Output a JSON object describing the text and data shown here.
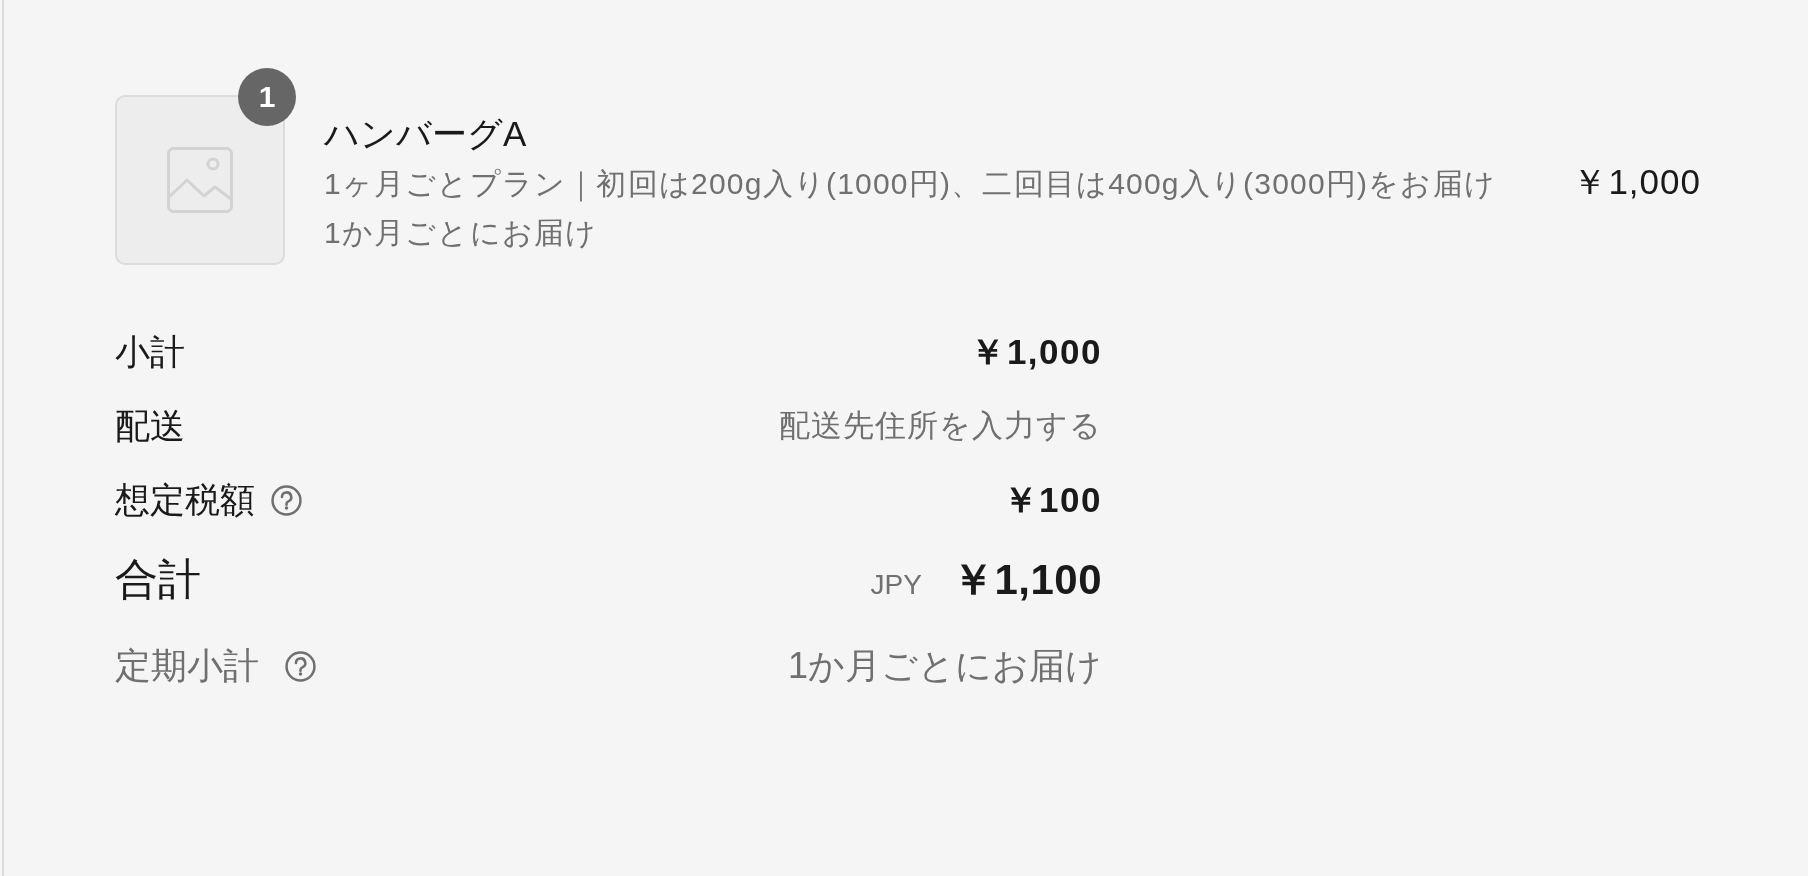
{
  "order_summary": {
    "line_items": [
      {
        "name": "ハンバーグA",
        "quantity": "1",
        "plan": "1ヶ月ごとプラン｜初回は200g入り(1000円)、二回目は400g入り(3000円)をお届け",
        "delivery": "1か月ごとにお届け",
        "price": "￥1,000"
      }
    ],
    "summary_rows": [
      {
        "kind": "line",
        "label": "小計",
        "help": false,
        "value": "￥1,000"
      },
      {
        "kind": "note",
        "label": "配送",
        "help": false,
        "value": "配送先住所を入力する"
      },
      {
        "kind": "line",
        "label": "想定税額",
        "help": true,
        "value": "￥100"
      },
      {
        "kind": "total",
        "label": "合計",
        "help": false,
        "currency": "JPY",
        "value": "￥1,100"
      },
      {
        "kind": "recurring",
        "label": "定期小計",
        "help": true,
        "value": "1か月ごとにお届け"
      }
    ]
  }
}
